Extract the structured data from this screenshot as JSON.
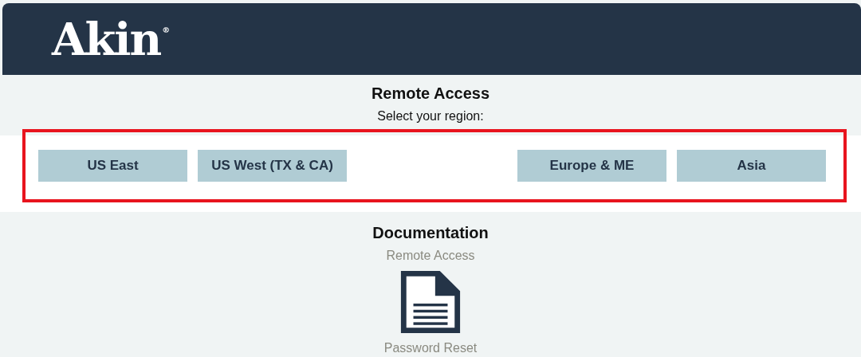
{
  "header": {
    "logo": "Akin",
    "logo_mark": "®"
  },
  "remote_access": {
    "title": "Remote Access",
    "prompt": "Select your region:",
    "highlighted": true,
    "region_groups": [
      {
        "regions": [
          "US East",
          "US West (TX & CA)"
        ]
      },
      {
        "regions": [
          "Europe & ME",
          "Asia"
        ]
      }
    ]
  },
  "documentation": {
    "title": "Documentation",
    "documents": [
      {
        "label": "Remote Access",
        "kind": "text"
      },
      {
        "label": "Password Reset",
        "kind": "icon"
      }
    ]
  }
}
